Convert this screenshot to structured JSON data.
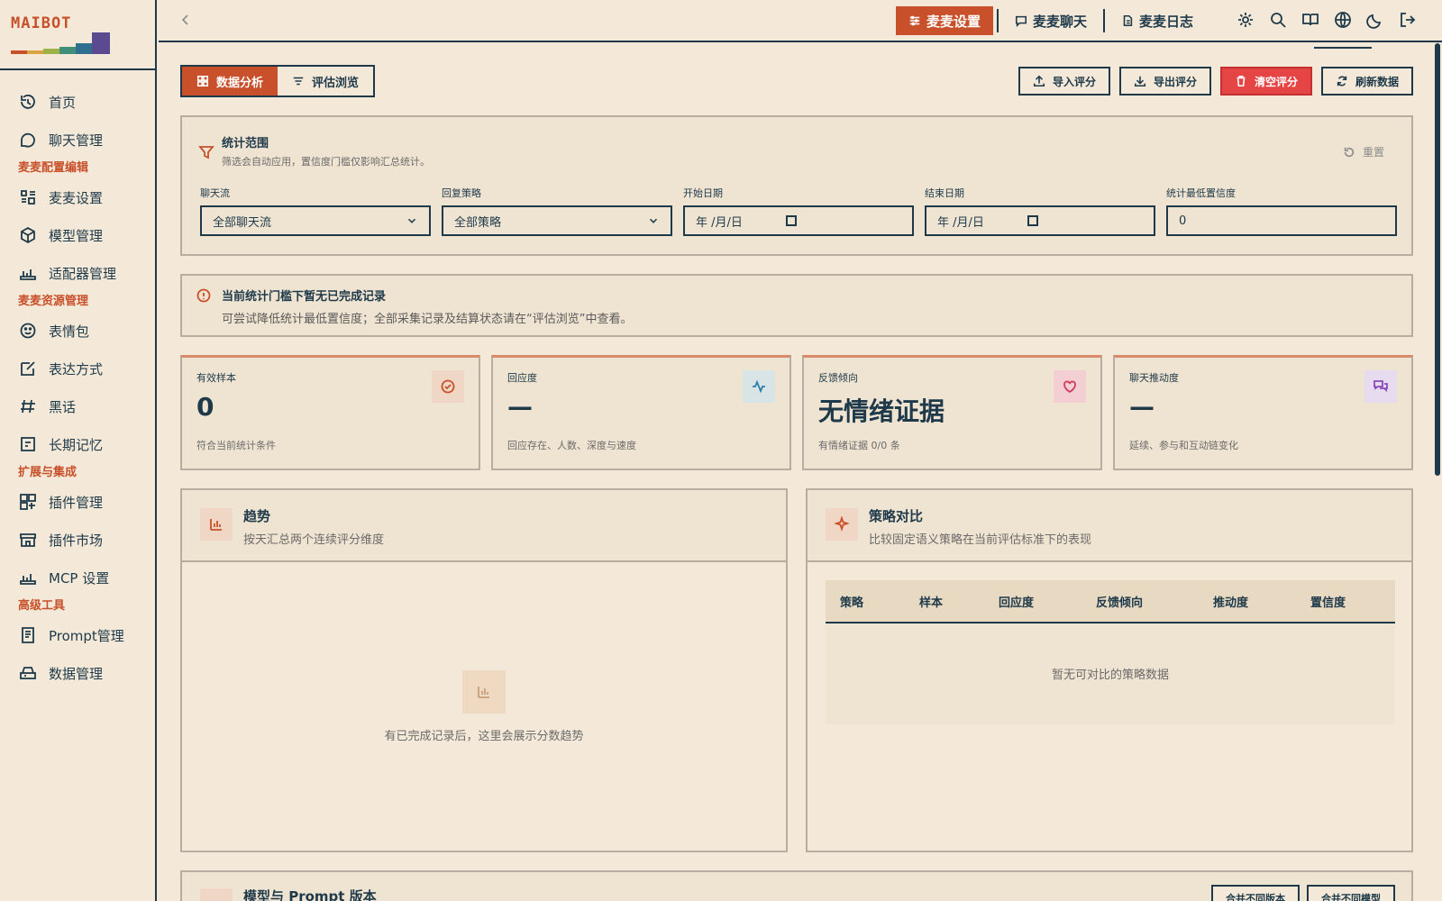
{
  "app": {
    "logo": "MAIBOT"
  },
  "sidebar": {
    "items": [
      {
        "type": "item",
        "label": "首页",
        "icon": "home-icon"
      },
      {
        "type": "item",
        "label": "聊天管理",
        "icon": "chat-icon"
      },
      {
        "type": "section",
        "label": "麦麦配置编辑"
      },
      {
        "type": "item",
        "label": "麦麦设置",
        "icon": "settings-icon"
      },
      {
        "type": "item",
        "label": "模型管理",
        "icon": "cube-icon"
      },
      {
        "type": "item",
        "label": "适配器管理",
        "icon": "adapter-icon"
      },
      {
        "type": "section",
        "label": "麦麦资源管理"
      },
      {
        "type": "item",
        "label": "表情包",
        "icon": "smile-icon"
      },
      {
        "type": "item",
        "label": "表达方式",
        "icon": "edit-icon"
      },
      {
        "type": "item",
        "label": "黑话",
        "icon": "hash-icon"
      },
      {
        "type": "item",
        "label": "长期记忆",
        "icon": "memory-icon"
      },
      {
        "type": "section",
        "label": "扩展与集成"
      },
      {
        "type": "item",
        "label": "插件管理",
        "icon": "plugin-icon"
      },
      {
        "type": "item",
        "label": "插件市场",
        "icon": "store-icon"
      },
      {
        "type": "item",
        "label": "MCP 设置",
        "icon": "mcp-icon"
      },
      {
        "type": "section",
        "label": "高级工具"
      },
      {
        "type": "item",
        "label": "Prompt管理",
        "icon": "prompt-icon"
      },
      {
        "type": "item",
        "label": "数据管理",
        "icon": "database-icon"
      }
    ]
  },
  "topbar": {
    "tabs": [
      "麦麦设置",
      "麦麦聊天",
      "麦麦日志"
    ]
  },
  "view_switch": {
    "analysis": "数据分析",
    "browse": "评估浏览"
  },
  "actions": {
    "import": "导入评分",
    "export": "导出评分",
    "clear": "清空评分",
    "refresh": "刷新数据"
  },
  "filter": {
    "title": "统计范围",
    "subtitle": "筛选会自动应用，置信度门槛仅影响汇总统计。",
    "reset": "重置",
    "fields": {
      "stream_label": "聊天流",
      "stream_value": "全部聊天流",
      "strategy_label": "回复策略",
      "strategy_value": "全部策略",
      "start_label": "开始日期",
      "start_value": "年 /月/日",
      "end_label": "结束日期",
      "end_value": "年 /月/日",
      "conf_label": "统计最低置信度",
      "conf_value": "0"
    }
  },
  "notice": {
    "title": "当前统计门槛下暂无已完成记录",
    "subtitle": "可尝试降低统计最低置信度；全部采集记录及结算状态请在“评估浏览”中查看。"
  },
  "stats": [
    {
      "label": "有效样本",
      "value": "0",
      "sub": "符合当前统计条件"
    },
    {
      "label": "回应度",
      "value": "—",
      "sub": "回应存在、人数、深度与速度"
    },
    {
      "label": "反馈倾向",
      "value": "无情绪证据",
      "sub": "有情绪证据 0/0 条"
    },
    {
      "label": "聊天推动度",
      "value": "—",
      "sub": "延续、参与和互动链变化"
    }
  ],
  "trend": {
    "title": "趋势",
    "subtitle": "按天汇总两个连续评分维度",
    "empty": "有已完成记录后，这里会展示分数趋势"
  },
  "compare": {
    "title": "策略对比",
    "subtitle": "比较固定语义策略在当前评估标准下的表现",
    "columns": [
      "策略",
      "样本",
      "回应度",
      "反馈倾向",
      "推动度",
      "置信度"
    ],
    "empty": "暂无可对比的策略数据"
  },
  "bottom": {
    "title": "模型与 Prompt 版本",
    "btn1": "合并不同版本",
    "btn2": "合并不同模型"
  },
  "colors": {
    "accent": "#c8502a",
    "danger": "#e64545",
    "ink": "#1e3a4a",
    "bg": "#f4e9d8"
  }
}
